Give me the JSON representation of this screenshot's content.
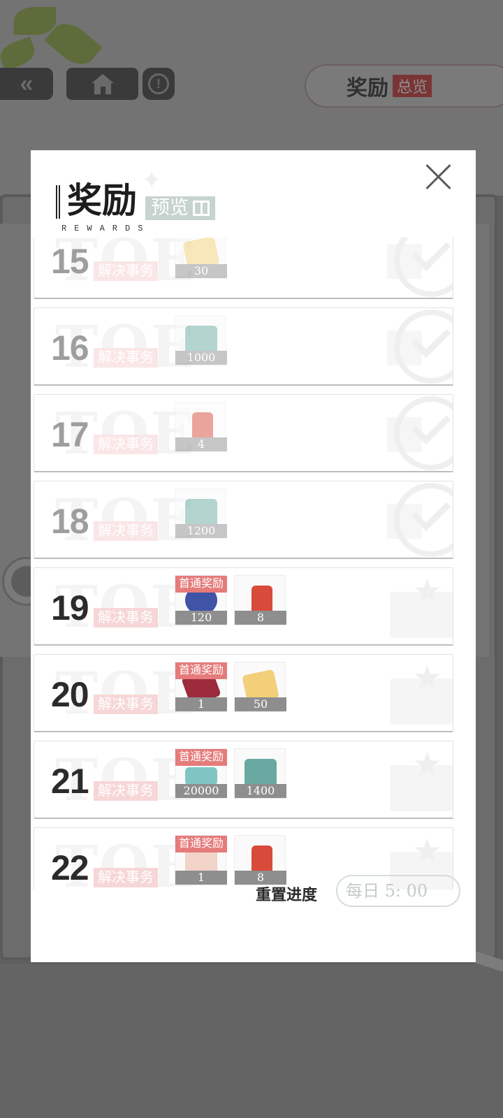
{
  "header": {
    "back_glyph": "«",
    "info_glyph": "!",
    "overview_title": "奖励",
    "overview_tag": "总览"
  },
  "modal": {
    "title": "奖励",
    "title_tag": "预览",
    "subtitle": "REWARDS",
    "rows": [
      {
        "num": "15",
        "ghost": "TOE",
        "task": "解决事务",
        "status": "claimed",
        "rewards": [
          {
            "icon": "paper-icon",
            "qty": "30",
            "first_clear": false
          }
        ]
      },
      {
        "num": "16",
        "ghost": "TOE",
        "task": "解决事务",
        "status": "claimed",
        "rewards": [
          {
            "icon": "book-icon",
            "qty": "1000",
            "first_clear": false
          }
        ]
      },
      {
        "num": "17",
        "ghost": "TOE",
        "task": "解决事务",
        "status": "claimed",
        "rewards": [
          {
            "icon": "charm-icon",
            "qty": "4",
            "first_clear": false
          }
        ]
      },
      {
        "num": "18",
        "ghost": "TOE",
        "task": "解决事务",
        "status": "claimed",
        "rewards": [
          {
            "icon": "book-icon",
            "qty": "1200",
            "first_clear": false
          }
        ]
      },
      {
        "num": "19",
        "ghost": "TOE",
        "task": "解决事务",
        "status": "pending",
        "rewards": [
          {
            "icon": "cube-icon",
            "qty": "120",
            "first_clear": true
          },
          {
            "icon": "charm-icon",
            "qty": "8",
            "first_clear": false
          }
        ]
      },
      {
        "num": "20",
        "ghost": "TOE",
        "task": "解决事务",
        "status": "pending",
        "rewards": [
          {
            "icon": "card-icon",
            "qty": "1",
            "first_clear": true
          },
          {
            "icon": "paper-icon",
            "qty": "50",
            "first_clear": false
          }
        ]
      },
      {
        "num": "21",
        "ghost": "TOE",
        "task": "解决事务",
        "status": "pending",
        "rewards": [
          {
            "icon": "money-icon",
            "qty": "20000",
            "first_clear": true
          },
          {
            "icon": "book-icon",
            "qty": "1400",
            "first_clear": false
          }
        ]
      },
      {
        "num": "22",
        "ghost": "TOE",
        "task": "解决事务",
        "status": "pending",
        "rewards": [
          {
            "icon": "face-icon",
            "qty": "1",
            "first_clear": true
          },
          {
            "icon": "charm-icon",
            "qty": "8",
            "first_clear": false
          }
        ]
      }
    ],
    "first_clear_label": "首通奖励",
    "reset_label": "重置进度",
    "reset_time": "每日  5: 00"
  }
}
